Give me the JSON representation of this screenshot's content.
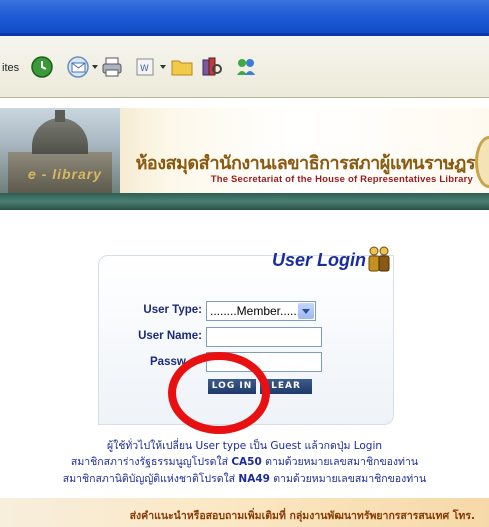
{
  "toolbar": {
    "favorites_label": "ites",
    "icons": [
      "history-icon",
      "mail-icon",
      "print-icon",
      "edit-icon",
      "folder-icon",
      "research-icon",
      "messenger-icon"
    ]
  },
  "banner": {
    "elibrary": "e - library",
    "title_th": "ห้องสมุดสำนักงานเลขาธิการสภาผู้แทนราษฎร",
    "title_en": "The Secretariat of the House of Representatives Library"
  },
  "login": {
    "title": "User Login",
    "user_type_label": "User Type:",
    "user_type_value": "........Member........",
    "user_name_label": "User Name:",
    "password_label": "Passw",
    "login_button": "LOG IN",
    "clear_button": "LEAR"
  },
  "info": {
    "line1": "ผู้ใช้ทั่วไปให้เปลี่ยน User type เป็น Guest แล้วกดปุ่ม Login",
    "line2_pre": "สมาชิกสภาร่างรัฐธรรมนูญโปรดใส่",
    "line2_code": "CA50",
    "line2_post": "ตามด้วยหมายเลขสมาชิกของท่าน",
    "line3_pre": "สมาชิกสภานิติบัญญัติแห่งชาติโปรดใส่",
    "line3_code": "NA49",
    "line3_post": "ตามด้วยหมายเลขสมาชิกของท่าน"
  },
  "footer": {
    "text": "ส่งคำแนะนำหรือสอบถามเพิ่มเติมที่ กลุ่มงานพัฒนาทรัพยากรสารสนเทศ โทร."
  },
  "colors": {
    "accent": "#1c2d9a",
    "annotation": "#e81010",
    "banner_bar": "#3c6e63"
  }
}
